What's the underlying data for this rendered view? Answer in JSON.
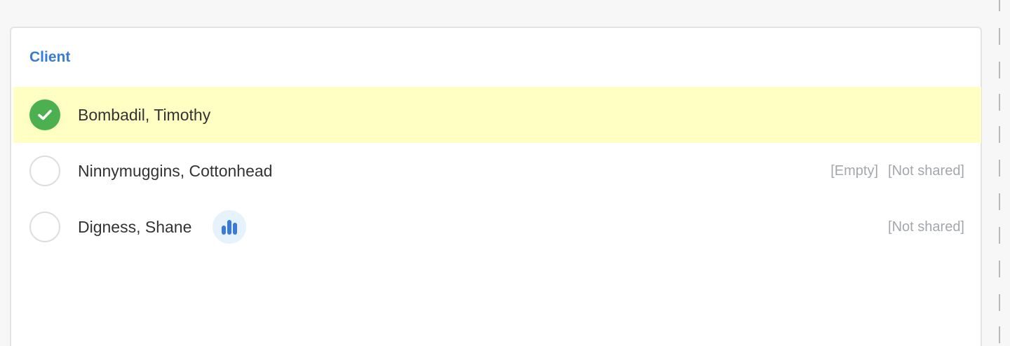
{
  "panel": {
    "title": "Client"
  },
  "clients": [
    {
      "name": "Bombadil, Timothy",
      "selected": true,
      "status_labels": []
    },
    {
      "name": "Ninnymuggins, Cottonhead",
      "selected": false,
      "status_labels": [
        "[Empty]",
        "[Not shared]"
      ]
    },
    {
      "name": "Digness, Shane",
      "selected": false,
      "has_stats_icon": true,
      "status_labels": [
        "[Not shared]"
      ]
    }
  ],
  "colors": {
    "accent": "#3a7bd5",
    "selected_row": "#ffffc4",
    "check_green": "#4caf50",
    "muted_text": "#a3a6ab"
  },
  "icons": {
    "checked": "check-circle-icon",
    "unchecked": "radio-empty-icon",
    "stats": "bar-chart-icon"
  }
}
